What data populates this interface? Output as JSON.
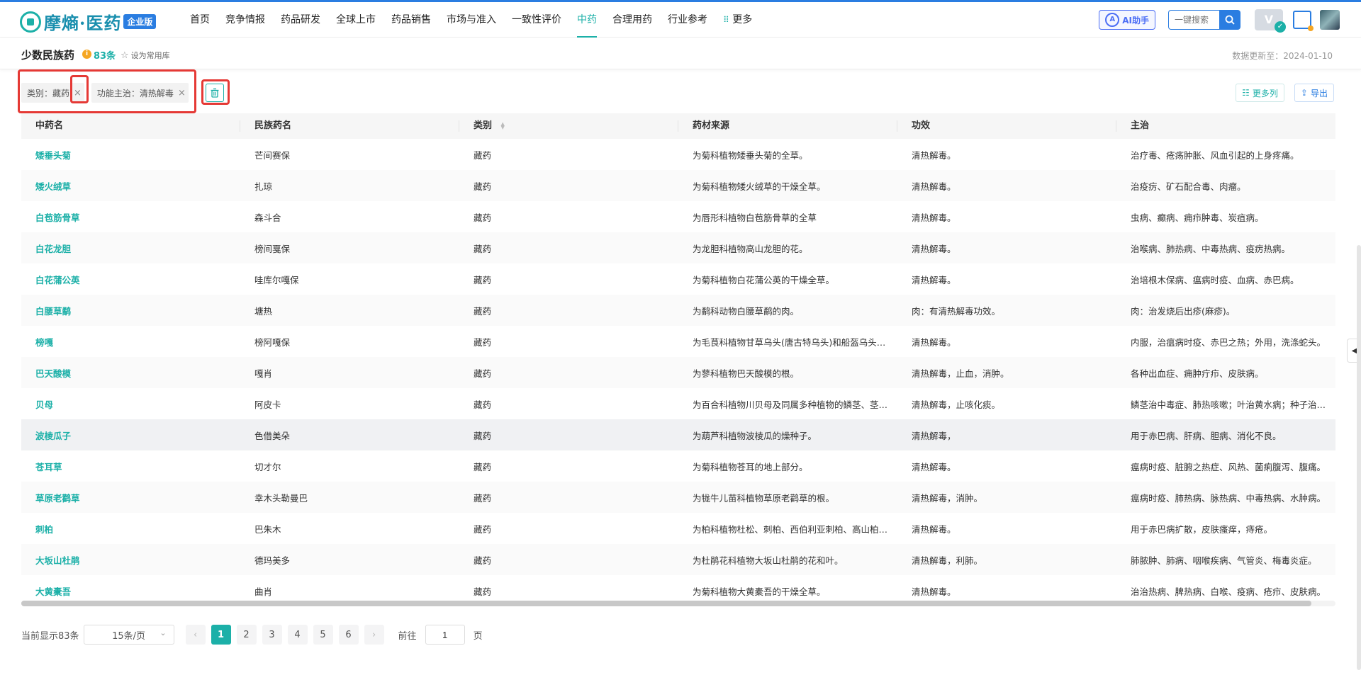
{
  "app": {
    "logo_text": "摩熵·医药",
    "edition_badge": "企业版"
  },
  "nav": {
    "items": [
      {
        "label": "首页",
        "active": false
      },
      {
        "label": "竞争情报",
        "active": false
      },
      {
        "label": "药品研发",
        "active": false
      },
      {
        "label": "全球上市",
        "active": false
      },
      {
        "label": "药品销售",
        "active": false
      },
      {
        "label": "市场与准入",
        "active": false
      },
      {
        "label": "一致性评价",
        "active": false
      },
      {
        "label": "中药",
        "active": true
      },
      {
        "label": "合理用药",
        "active": false
      },
      {
        "label": "行业参考",
        "active": false
      }
    ],
    "more_label": "更多",
    "ai_label": "AI助手",
    "search_placeholder": "一键搜索"
  },
  "page": {
    "title": "少数民族药",
    "count": "83条",
    "favorite_label": "设为常用库",
    "update_text": "数据更新至：2024-01-10"
  },
  "filters": {
    "tags": [
      {
        "label": "类别：藏药"
      },
      {
        "label": "功能主治：清热解毒"
      }
    ],
    "more_columns_label": "更多列",
    "export_label": "导出"
  },
  "table": {
    "columns": [
      "中药名",
      "民族药名",
      "类别",
      "药材来源",
      "功效",
      "主治"
    ],
    "rows": [
      [
        "矮垂头菊",
        "芒间赛保",
        "藏药",
        "为菊科植物矮垂头菊的全草。",
        "清热解毒。",
        "治疗毒、疮疡肿胀、风血引起的上身疼痛。"
      ],
      [
        "矮火绒草",
        "扎琼",
        "藏药",
        "为菊科植物矮火绒草的干燥全草。",
        "清热解毒。",
        "治疫疠、矿石配合毒、肉瘤。"
      ],
      [
        "白苞筋骨草",
        "森斗合",
        "藏药",
        "为唇形科植物白苞筋骨草的全草",
        "清热解毒。",
        "虫病、癫病、痈疖肿毒、炭疽病。"
      ],
      [
        "白花龙胆",
        "榜间戛保",
        "藏药",
        "为龙胆科植物高山龙胆的花。",
        "清热解毒。",
        "治喉病、肺热病、中毒热病、疫疠热病。"
      ],
      [
        "白花蒲公英",
        "哇库尔嘎保",
        "藏药",
        "为菊科植物白花蒲公英的干燥全草。",
        "清热解毒。",
        "治培根木保病、瘟病时疫、血病、赤巴病。"
      ],
      [
        "白腰草鹬",
        "塘热",
        "藏药",
        "为鹬科动物白腰草鹬的肉。",
        "肉：有清热解毒功效。",
        "肉：治发烧后出疹(麻疹)。"
      ],
      [
        "榜嘎",
        "榜阿嘎保",
        "藏药",
        "为毛茛科植物甘草乌头(唐古特乌头)和船盔乌头的全草。",
        "清热解毒。",
        "内服，治瘟病时疫、赤巴之热；外用，洗涤蛇头。"
      ],
      [
        "巴天酸模",
        "嘎肖",
        "藏药",
        "为蓼科植物巴天酸模的根。",
        "清热解毒，止血，消肿。",
        "各种出血症、痈肿疔疖、皮肤病。"
      ],
      [
        "贝母",
        "阿皮卡",
        "藏药",
        "为百合科植物川贝母及同属多种植物的鳞茎、茎叶。",
        "清热解毒，止咳化痰。",
        "鳞茎治中毒症、肺热咳嗽；叶治黄水病；种子治头痛。"
      ],
      [
        "波棱瓜子",
        "色借美朵",
        "藏药",
        "为葫芦科植物波棱瓜的燥种子。",
        "清热解毒，",
        "用于赤巴病、肝病、胆病、消化不良。"
      ],
      [
        "苍耳草",
        "切才尔",
        "藏药",
        "为菊科植物苍耳的地上部分。",
        "清热解毒。",
        "瘟病时疫、脏腑之热症、风热、菌痢腹泻、腹痛。"
      ],
      [
        "草原老鹳草",
        "幸木头勒曼巴",
        "藏药",
        "为牻牛儿苗科植物草原老鹳草的根。",
        "清热解毒，消肿。",
        "瘟病时疫、肺热病、脉热病、中毒热病、水肿病。"
      ],
      [
        "刺柏",
        "巴朱木",
        "藏药",
        "为柏科植物杜松、刺柏、西伯利亚刺柏、高山柏的枝叶。",
        "清热解毒。",
        "用于赤巴病扩散，皮肤瘙痒，痔疮。"
      ],
      [
        "大坂山杜鹃",
        "德玛美多",
        "藏药",
        "为杜鹃花科植物大坂山杜鹃的花和叶。",
        "清热解毒，利肺。",
        "肺脓肿、肺病、咽喉疾病、气管炎、梅毒炎症。"
      ],
      [
        "大黄橐吾",
        "曲肖",
        "藏药",
        "为菊科植物大黄橐吾的干燥全草。",
        "清热解毒。",
        "治治热病、脾热病、白喉、疫病、疮疖、皮肤病。"
      ]
    ]
  },
  "pagination": {
    "summary": "当前显示83条",
    "page_size": "15条/页",
    "pages": [
      "1",
      "2",
      "3",
      "4",
      "5",
      "6"
    ],
    "current_page": "1",
    "goto_label": "前往",
    "goto_value": "1",
    "page_suffix": "页"
  },
  "colors": {
    "accent": "#1cb0a8",
    "brand_blue": "#2a7de1",
    "highlight_red": "#e53935"
  }
}
